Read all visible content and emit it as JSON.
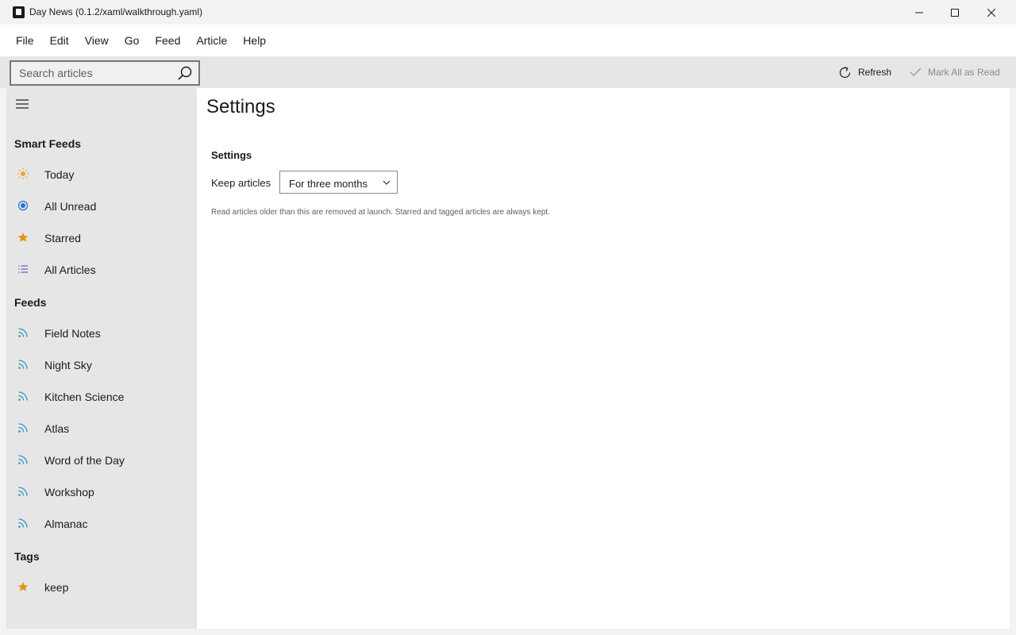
{
  "window": {
    "title": "Day News (0.1.2/xaml/walkthrough.yaml)"
  },
  "menu": {
    "items": [
      "File",
      "Edit",
      "View",
      "Go",
      "Feed",
      "Article",
      "Help"
    ]
  },
  "toolbar": {
    "search_placeholder": "Search articles",
    "refresh_label": "Refresh",
    "mark_all_label": "Mark All as Read"
  },
  "sidebar": {
    "smart_feeds_header": "Smart Feeds",
    "smart_feeds": [
      {
        "label": "Today",
        "icon": "sun-icon"
      },
      {
        "label": "All Unread",
        "icon": "radio-dot-icon"
      },
      {
        "label": "Starred",
        "icon": "star-icon"
      },
      {
        "label": "All Articles",
        "icon": "list-icon"
      }
    ],
    "feeds_header": "Feeds",
    "feeds": [
      {
        "label": "Field Notes",
        "icon": "rss-icon"
      },
      {
        "label": "Night Sky",
        "icon": "rss-icon"
      },
      {
        "label": "Kitchen Science",
        "icon": "rss-icon"
      },
      {
        "label": "Atlas",
        "icon": "rss-icon"
      },
      {
        "label": "Word of the Day",
        "icon": "rss-icon"
      },
      {
        "label": "Workshop",
        "icon": "rss-icon"
      },
      {
        "label": "Almanac",
        "icon": "rss-icon"
      }
    ],
    "tags_header": "Tags",
    "tags": [
      {
        "label": "keep",
        "icon": "star-icon"
      }
    ]
  },
  "main": {
    "page_title": "Settings",
    "section_header": "Settings",
    "keep_articles_label": "Keep articles",
    "keep_articles_value": "For three months",
    "keep_articles_help": "Read articles older than this are removed at launch. Starred and tagged articles are always kept."
  },
  "colors": {
    "sun": "#f5a623",
    "unread": "#1a73e8",
    "star": "#e8920c",
    "list": "#5b5fc7",
    "rss": "#2f8fbf"
  }
}
